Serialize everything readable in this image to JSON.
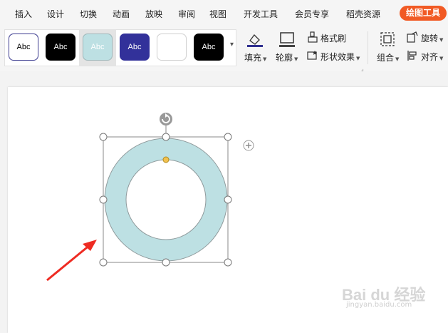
{
  "menu": {
    "tabs": [
      "插入",
      "设计",
      "切换",
      "动画",
      "放映",
      "审阅",
      "视图",
      "开发工具",
      "会员专享",
      "稻壳资源"
    ],
    "context_tab": "绘图工具"
  },
  "ribbon": {
    "styles": [
      {
        "label": "Abc",
        "bg": "#ffffff",
        "fg": "#000000",
        "border": "#3b3a8f"
      },
      {
        "label": "Abc",
        "bg": "#000000",
        "fg": "#ffffff",
        "border": "#000000"
      },
      {
        "label": "Abc",
        "bg": "#bde0e3",
        "fg": "#ffffff",
        "border": "#9fb7ba",
        "selected": true
      },
      {
        "label": "Abc",
        "bg": "#32319a",
        "fg": "#ffffff",
        "border": "#32319a"
      },
      {
        "label": "",
        "bg": "#ffffff",
        "fg": "#000000",
        "border": "#cfcfcf"
      },
      {
        "label": "Abc",
        "bg": "#000000",
        "fg": "#ffffff",
        "border": "#000000"
      }
    ],
    "fill": "填充",
    "outline": "轮廓",
    "format_painter": "格式刷",
    "shape_effects": "形状效果",
    "group": "组合",
    "rotate": "旋转",
    "align": "对齐"
  },
  "shape": {
    "fill_color": "#bde0e3",
    "stroke_color": "#8f9a9c",
    "handle_color": "#999999",
    "arrow_color": "#ee2b22"
  },
  "watermark": {
    "main": "Bai du 经验",
    "sub": "jingyan.baidu.com"
  }
}
